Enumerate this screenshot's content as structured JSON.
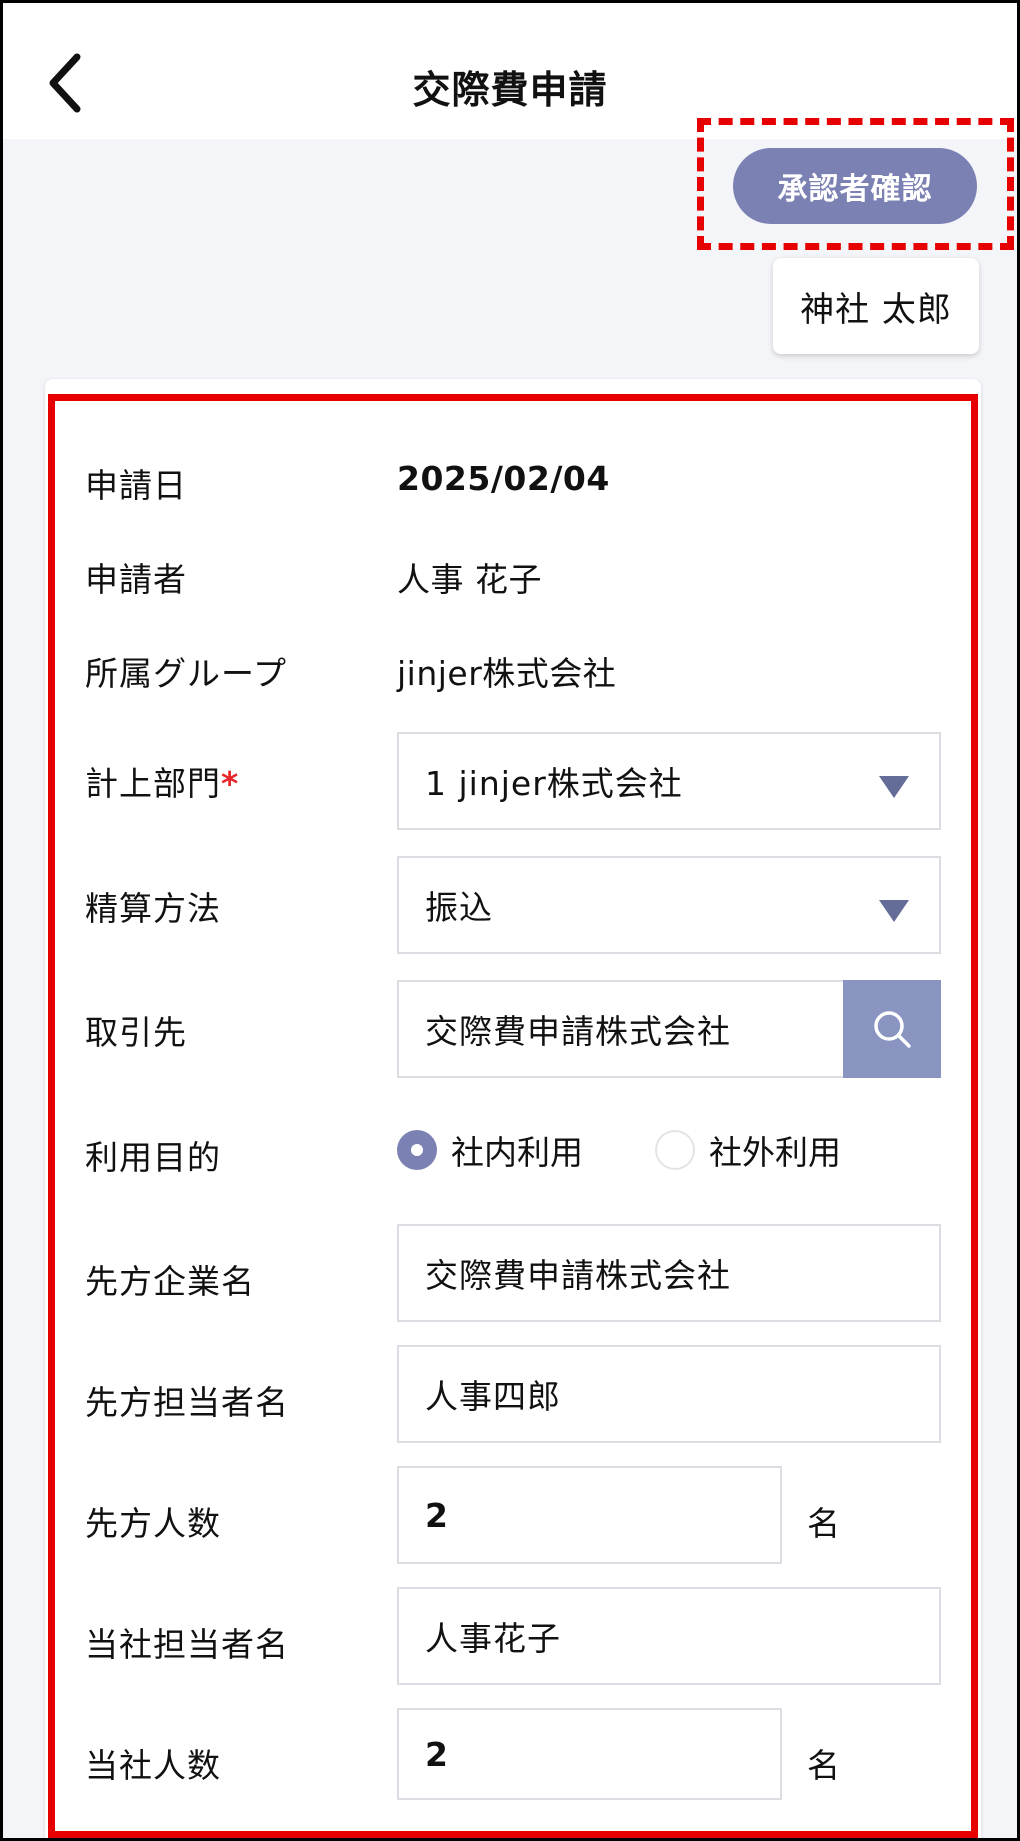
{
  "header": {
    "title": "交際費申請"
  },
  "actions": {
    "approve_label": "承認者確認",
    "approver_name": "神社 太郎"
  },
  "info": {
    "date_label": "申請日",
    "date_value": "2025/02/04",
    "applicant_label": "申請者",
    "applicant_value": "人事 花子",
    "group_label": "所属グループ",
    "group_value": "jinjer株式会社"
  },
  "form": {
    "dept_label": "計上部門",
    "dept_required": "*",
    "dept_value": "1 jinjer株式会社",
    "payment_label": "精算方法",
    "payment_value": "振込",
    "client_label": "取引先",
    "client_value": "交際費申請株式会社",
    "purpose_label": "利用目的",
    "purpose_internal": "社内利用",
    "purpose_external": "社外利用",
    "purpose_selected": "社内利用",
    "partner_company_label": "先方企業名",
    "partner_company_value": "交際費申請株式会社",
    "partner_person_label": "先方担当者名",
    "partner_person_value": "人事四郎",
    "partner_count_label": "先方人数",
    "partner_count_value": "2",
    "partner_count_unit": "名",
    "our_person_label": "当社担当者名",
    "our_person_value": "人事花子",
    "our_count_label": "当社人数",
    "our_count_value": "2",
    "our_count_unit": "名"
  },
  "colors": {
    "accent": "#7b81b3",
    "search_button": "#8995c0",
    "highlight": "#e60000",
    "required": "#e8262a"
  }
}
